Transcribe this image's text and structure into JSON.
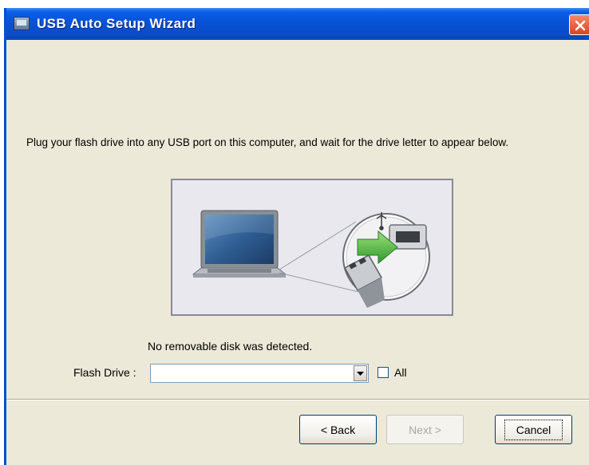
{
  "window": {
    "title": "USB Auto Setup Wizard"
  },
  "instructions": "Plug your flash drive into any USB port on this computer, and wait for the drive letter to appear below.",
  "status_message": "No removable disk was detected.",
  "flash_drive": {
    "label": "Flash Drive :",
    "value": ""
  },
  "all_checkbox": {
    "label": "All",
    "checked": false
  },
  "buttons": {
    "back": "< Back",
    "next": "Next >",
    "cancel": "Cancel"
  },
  "icons": [
    "app-icon",
    "close-icon",
    "laptop-illustration",
    "usb-icon",
    "dropdown-arrow-icon"
  ]
}
